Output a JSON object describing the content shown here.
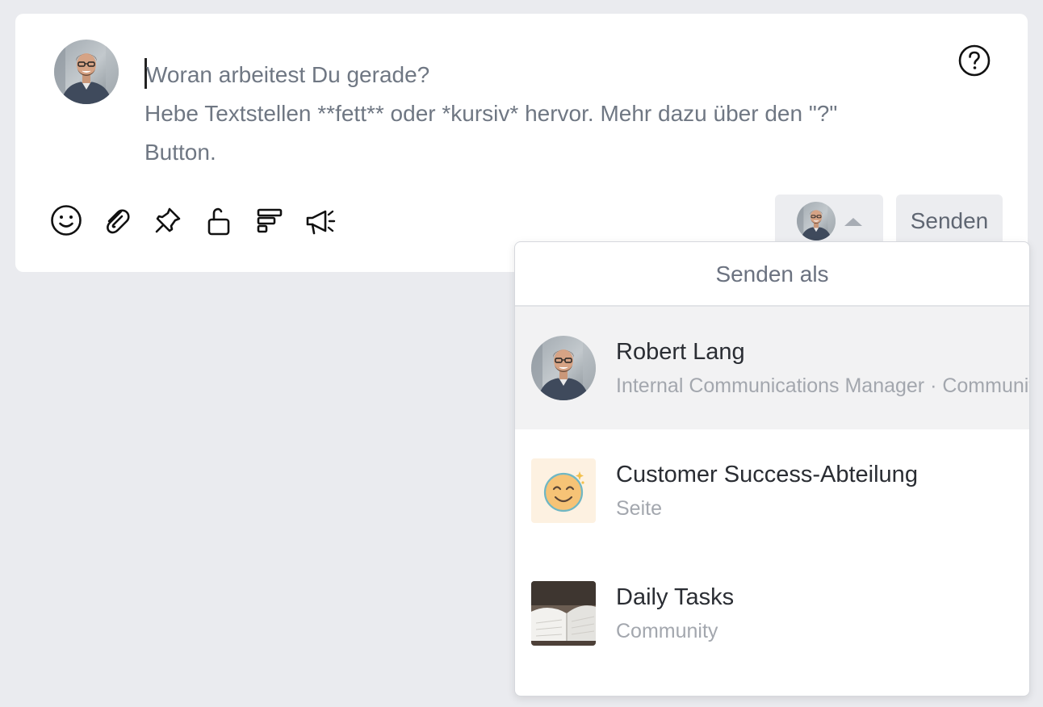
{
  "composer": {
    "placeholder_line1": "Woran arbeitest Du gerade?",
    "placeholder_line2": "Hebe Textstellen **fett** oder *kursiv* hervor. Mehr dazu über den \"?\"",
    "placeholder_line3": "Button.",
    "help_icon": "question-circle-icon"
  },
  "toolbar": {
    "tools": [
      "emoji-icon",
      "paperclip-icon",
      "pin-icon",
      "unlock-icon",
      "poll-icon",
      "megaphone-icon"
    ],
    "send_label": "Senden"
  },
  "dropdown": {
    "header": "Senden als",
    "items": [
      {
        "title": "Robert Lang",
        "subtitle": "Internal Communications Manager · Community Manager"
      },
      {
        "title": "Customer Success-Abteilung",
        "subtitle": "Seite"
      },
      {
        "title": "Daily Tasks",
        "subtitle": "Community"
      }
    ]
  },
  "colors": {
    "background": "#eaebef",
    "card": "#ffffff",
    "placeholder": "#6f7783",
    "active_row": "#f2f2f3"
  }
}
